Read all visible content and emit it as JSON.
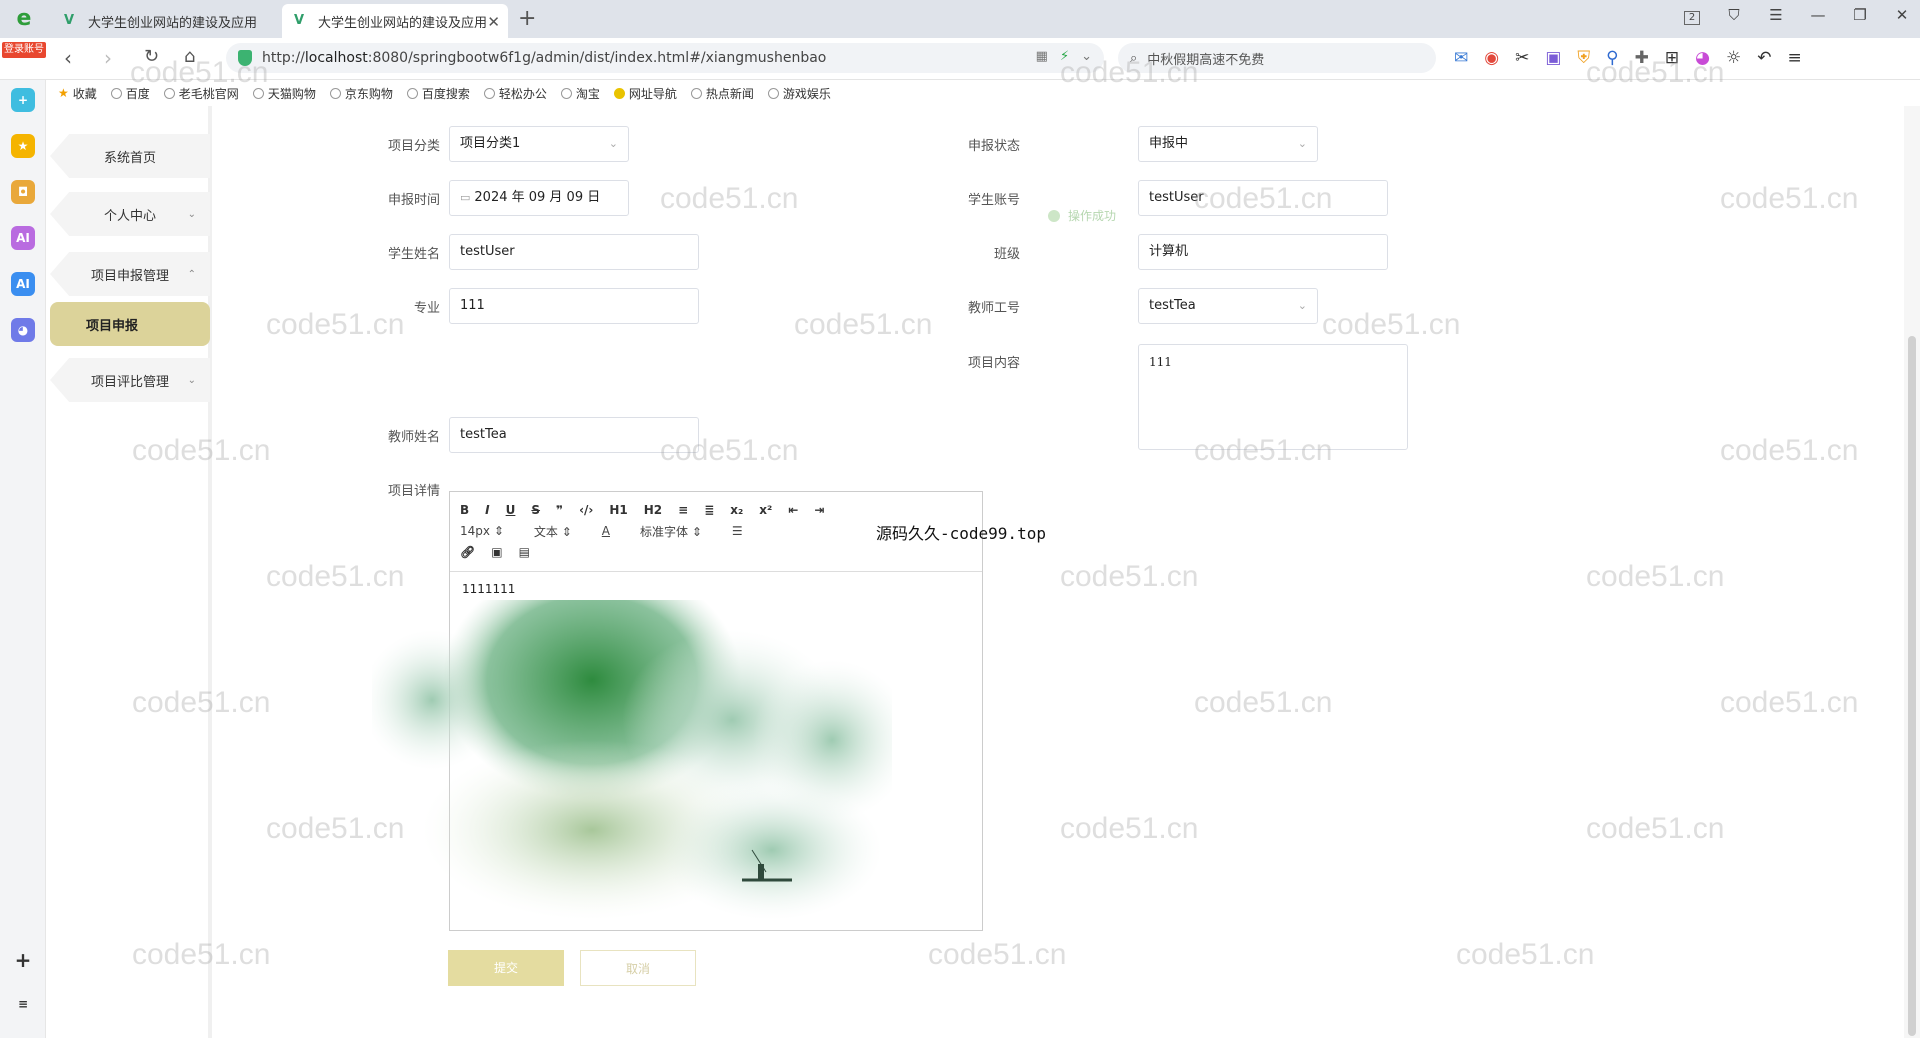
{
  "browser": {
    "login_badge": "登录账号",
    "tabs": [
      {
        "title": "大学生创业网站的建设及应用"
      },
      {
        "title": "大学生创业网站的建设及应用"
      }
    ],
    "new_tab": "+",
    "window_controls": {
      "tab_count": "2"
    },
    "url": {
      "prefix": "http://",
      "host": "localhost",
      "rest": ":8080/springbootw6f1g/admin/dist/index.html#/xiangmushenbao"
    },
    "search_text": "中秋假期高速不免费",
    "bookmarks": [
      "收藏",
      "百度",
      "老毛桃官网",
      "天猫购物",
      "京东购物",
      "百度搜索",
      "轻松办公",
      "淘宝",
      "网址导航",
      "热点新闻",
      "游戏娱乐"
    ]
  },
  "sidebar": {
    "items": [
      {
        "label": "系统首页"
      },
      {
        "label": "个人中心"
      },
      {
        "label": "项目申报管理"
      },
      {
        "label": "项目申报"
      },
      {
        "label": "项目评比管理"
      }
    ]
  },
  "toast": {
    "text": "操作成功"
  },
  "form": {
    "category": {
      "label": "项目分类",
      "value": "项目分类1"
    },
    "status": {
      "label": "申报状态",
      "value": "申报中"
    },
    "date": {
      "label": "申报时间",
      "value": "2024 年 09 月 09 日"
    },
    "student_account": {
      "label": "学生账号",
      "value": "testUser"
    },
    "student_name": {
      "label": "学生姓名",
      "value": "testUser"
    },
    "class": {
      "label": "班级",
      "value": "计算机"
    },
    "major": {
      "label": "专业",
      "value": "111"
    },
    "teacher_id": {
      "label": "教师工号",
      "value": "testTea"
    },
    "content": {
      "label": "项目内容",
      "value": "111"
    },
    "teacher_name": {
      "label": "教师姓名",
      "value": "testTea"
    },
    "details": {
      "label": "项目详情"
    }
  },
  "editor": {
    "toolbar_row1": [
      "B",
      "I",
      "U",
      "S",
      "❞",
      "‹/›",
      "H1",
      "H2",
      "≡",
      "≣",
      "x₂",
      "x²",
      "⇤",
      "⇥"
    ],
    "font_size": "14px",
    "text_style": "文本",
    "font_family": "标准字体",
    "body_text": "1111111",
    "watermark": "源码久久-code99.top"
  },
  "buttons": {
    "ok": "提交",
    "cancel": "取消"
  },
  "watermark": "code51.cn"
}
